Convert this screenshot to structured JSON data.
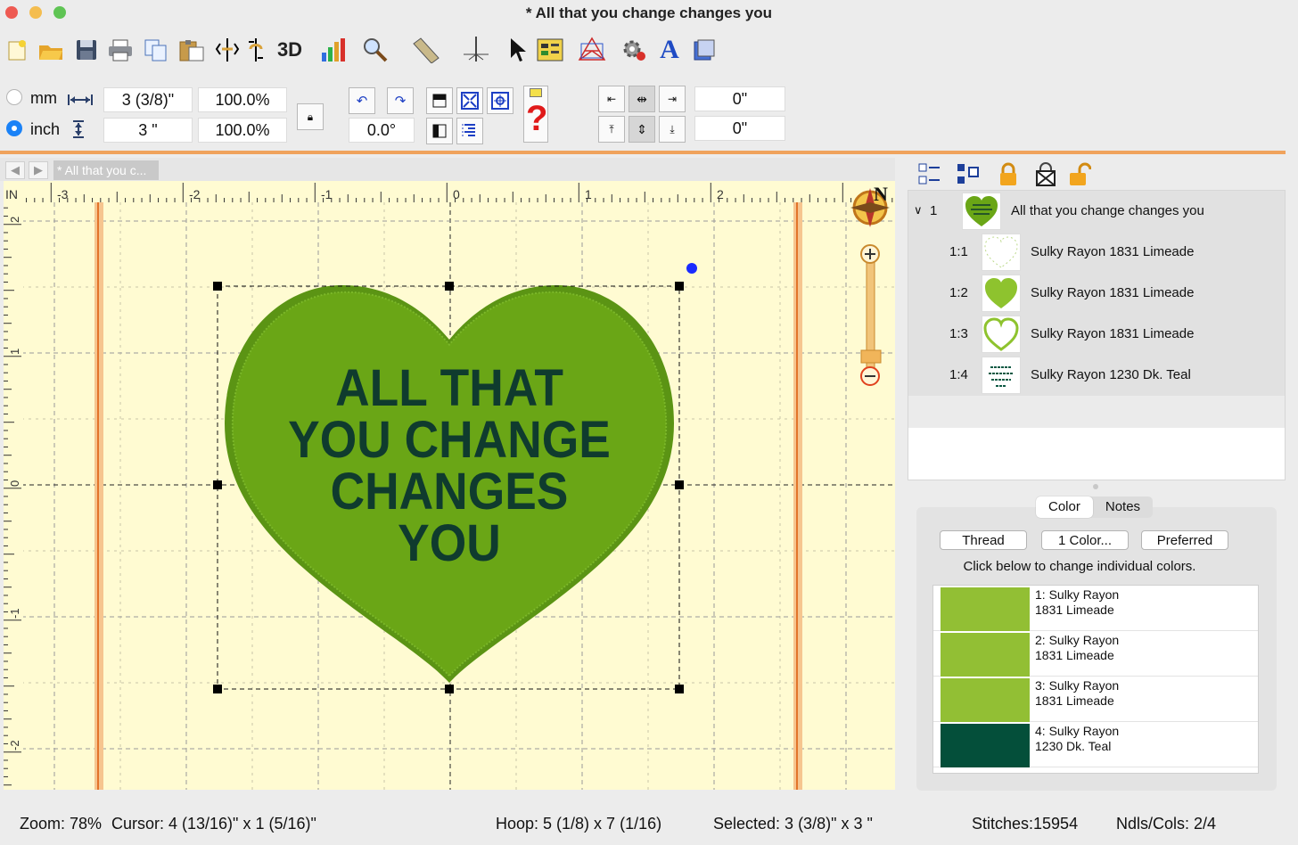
{
  "window": {
    "title": "* All that you change changes you"
  },
  "toolbar": {
    "icons": [
      "new-icon",
      "open-icon",
      "save-icon",
      "print-icon",
      "copy-icon",
      "paste-icon",
      "mirror-horizontal-icon",
      "mirror-vertical-icon",
      "3d-view-icon",
      "chart-icon",
      "zoom-icon",
      "ruler-icon",
      "needle-icon",
      "pointer-icon",
      "properties-icon",
      "wireframe-icon",
      "settings-icon",
      "text-icon",
      "export-icon"
    ],
    "threed_label": "3D"
  },
  "sizebar": {
    "unit_mm": "mm",
    "unit_inch": "inch",
    "width_value": "3 (3/8)\"",
    "height_value": "3 \"",
    "width_percent": "100.0%",
    "height_percent": "100.0%",
    "rotation_value": "0.0°",
    "offset_x": "0\"",
    "offset_y": "0\"",
    "help_glyph": "?"
  },
  "canvas": {
    "tab_title": "* All that you c...",
    "ruler_unit": "IN",
    "top_ticks": [
      "-3",
      "-2",
      "-1",
      "0",
      "1",
      "2"
    ],
    "left_ticks": [
      "2",
      "1",
      "0",
      "-1",
      "-2"
    ],
    "compass_letter": "N",
    "design_text": [
      "ALL THAT",
      "YOU CHANGE",
      "CHANGES",
      "YOU"
    ],
    "colors": {
      "fabric": "#fffbd2",
      "heart": "#6aa616",
      "heart_edge": "#5b9414",
      "text": "#0f3b2e"
    }
  },
  "layers": {
    "root": {
      "index": "1",
      "label": "All that you change changes you"
    },
    "items": [
      {
        "index": "1:1",
        "label": "Sulky Rayon 1831 Limeade"
      },
      {
        "index": "1:2",
        "label": "Sulky Rayon 1831 Limeade"
      },
      {
        "index": "1:3",
        "label": "Sulky Rayon 1831 Limeade"
      },
      {
        "index": "1:4",
        "label": "Sulky Rayon 1230 Dk. Teal"
      }
    ]
  },
  "color_panel": {
    "tabs": [
      "Color",
      "Notes"
    ],
    "buttons": [
      "Thread",
      "1 Color...",
      "Preferred"
    ],
    "hint": "Click below to change individual colors.",
    "threads": [
      {
        "line1": "1: Sulky Rayon",
        "line2": "1831 Limeade",
        "color": "#92bf34"
      },
      {
        "line1": "2: Sulky Rayon",
        "line2": "1831 Limeade",
        "color": "#92bf34"
      },
      {
        "line1": "3: Sulky Rayon",
        "line2": "1831 Limeade",
        "color": "#92bf34"
      },
      {
        "line1": "4: Sulky Rayon",
        "line2": "1230 Dk. Teal",
        "color": "#044f3a"
      }
    ]
  },
  "status": {
    "zoom": "Zoom: 78%",
    "cursor": "Cursor: 4 (13/16)\" x 1 (5/16)\"",
    "hoop": "Hoop: 5 (1/8) x 7 (1/16)",
    "selected": "Selected: 3 (3/8)\" x 3 \"",
    "stitches": "Stitches:15954",
    "ndls": "Ndls/Cols: 2/4"
  }
}
